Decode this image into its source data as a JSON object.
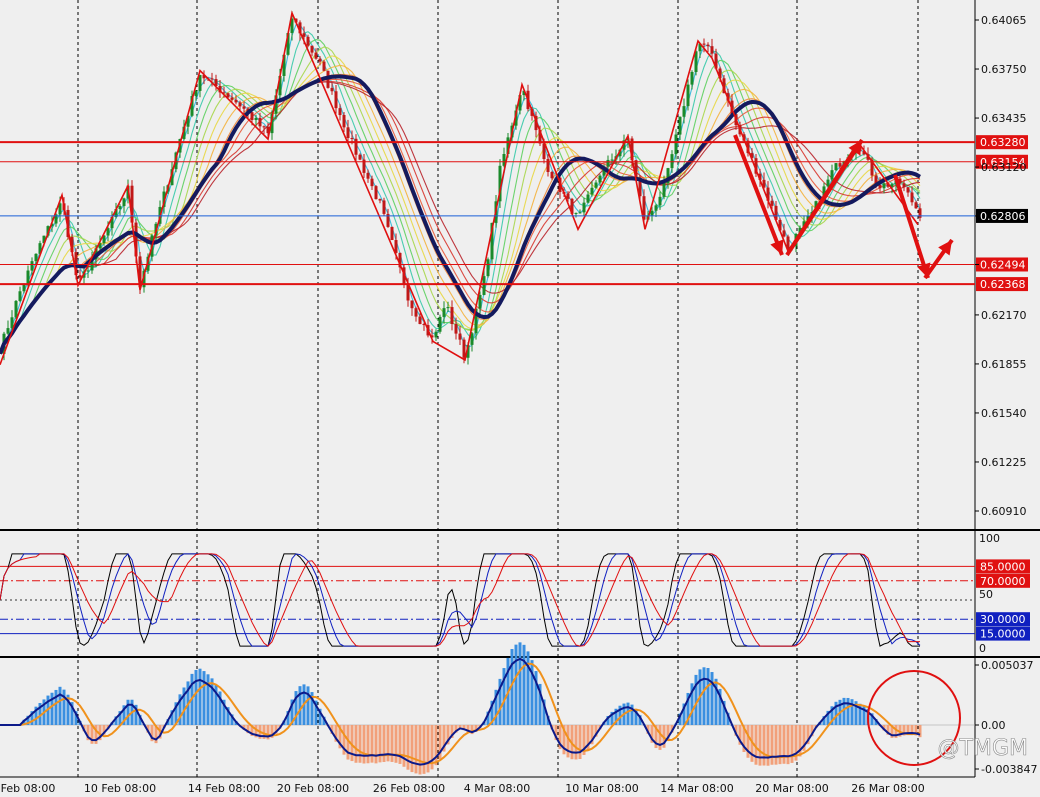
{
  "chart_data": [
    {
      "type": "candlestick",
      "panel": "price",
      "y_ticks": [
        "0.64065",
        "0.63750",
        "0.63435",
        "0.63120",
        "0.62806",
        "0.62494",
        "0.62170",
        "0.61855",
        "0.61540",
        "0.61225",
        "0.60910"
      ],
      "ylim": [
        0.6075,
        0.6418
      ],
      "grid": "dashed vertical",
      "current_price": {
        "value": 0.62806,
        "label": "0.62806",
        "color": "#1a5fd6"
      },
      "horizontal_lines": [
        {
          "value": 0.6328,
          "label": "0.63280",
          "color": "#e01010"
        },
        {
          "value": 0.63154,
          "label": "0.63154",
          "color": "#e01010"
        },
        {
          "value": 0.62494,
          "label": "0.62494",
          "color": "#e01010"
        },
        {
          "value": 0.62368,
          "label": "0.62368",
          "color": "#e01010"
        }
      ],
      "overlays": [
        "heavy moving average (navy)",
        "rainbow moving-average ribbon",
        "red zigzag line",
        "red arrows"
      ]
    },
    {
      "type": "line",
      "panel": "oscillator",
      "y_ticks": [
        "100",
        "50",
        "0"
      ],
      "levels": [
        {
          "value": 85,
          "label": "85.0000",
          "color": "#e01010",
          "tag": "#e01010"
        },
        {
          "value": 70,
          "label": "70.0000",
          "color": "#e01010",
          "tag": "#e01010"
        },
        {
          "value": 30,
          "label": "30.0000",
          "color": "#1020c0",
          "tag": "#1020c0"
        },
        {
          "value": 15,
          "label": "15.0000",
          "color": "#1020c0",
          "tag": "#1020c0"
        }
      ],
      "series_colors": [
        "#000000",
        "#1020c0",
        "#e01010"
      ]
    },
    {
      "type": "bar",
      "panel": "macd",
      "y_ticks": [
        "0.005037",
        "0.00",
        "-0.003847"
      ],
      "series_colors": {
        "positive": "#3a8fe0",
        "negative": "#f2a07a",
        "signal": "#f0921c",
        "macd": "#0c1a8a"
      },
      "annotation": "red circle"
    }
  ],
  "x_axis": {
    "labels": [
      "Feb 08:00",
      "10 Feb 08:00",
      "14 Feb 08:00",
      "20 Feb 08:00",
      "26 Feb 08:00",
      "4 Mar 08:00",
      "10 Mar 08:00",
      "14 Mar 08:00",
      "20 Mar 08:00",
      "26 Mar 08:00"
    ]
  },
  "watermark": "@TMGM",
  "colors": {
    "background": "#efefef",
    "grid": "#000000",
    "tag_red": "#e01010",
    "tag_blue": "#1a5fd6"
  }
}
